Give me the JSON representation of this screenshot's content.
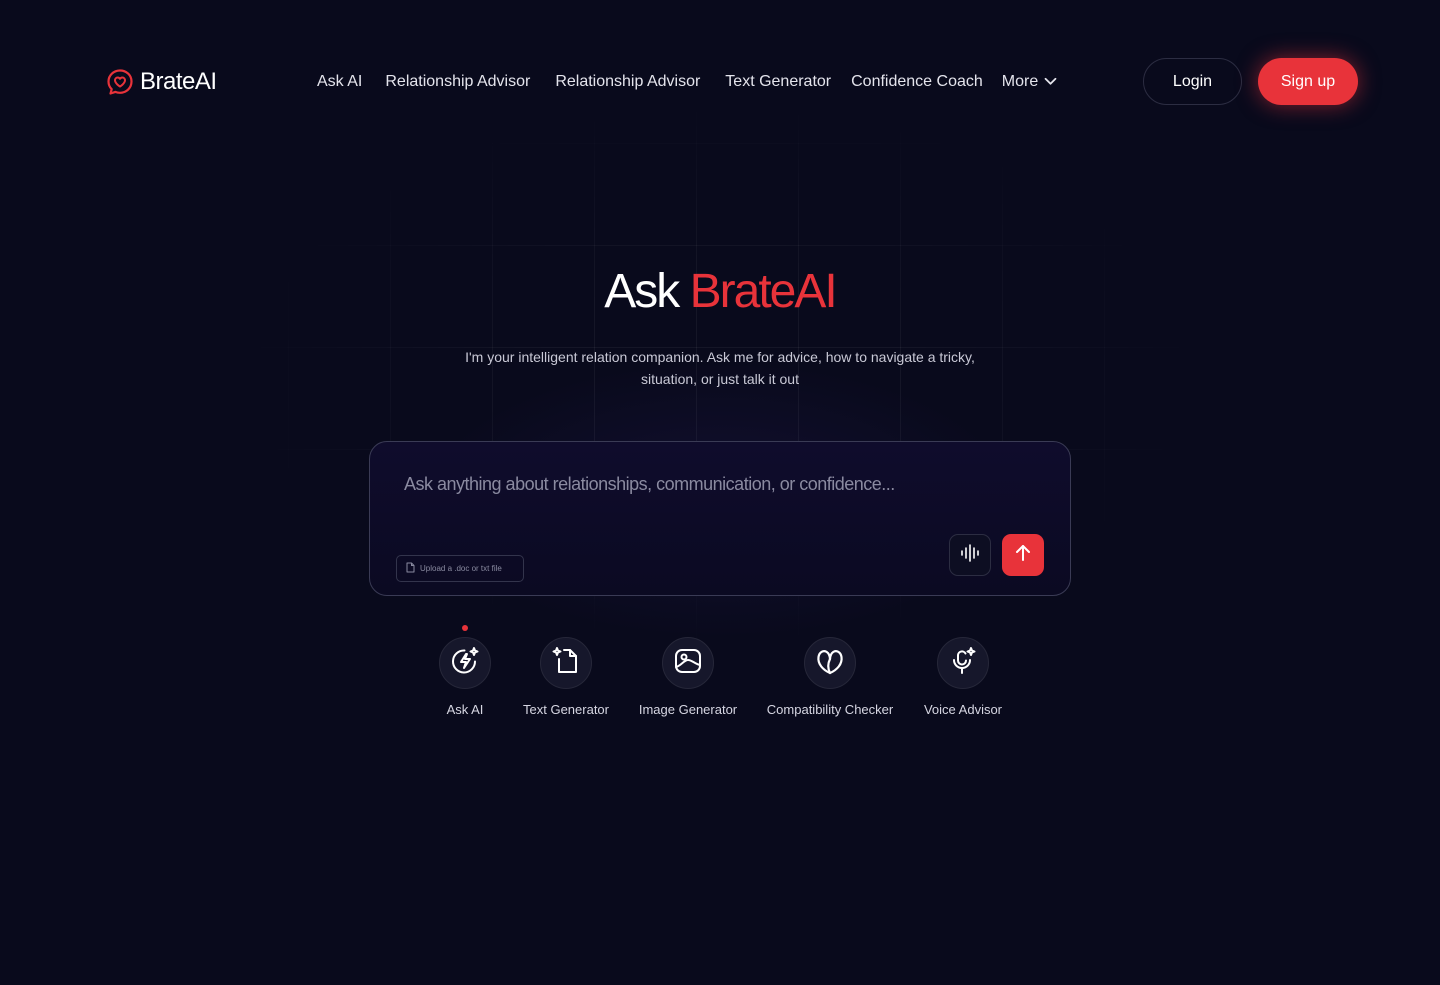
{
  "brand": {
    "name": "BrateAI",
    "accent_color": "#e8333a",
    "logo_icon": "chat-heart-icon"
  },
  "nav": {
    "items": [
      {
        "label": "Ask AI"
      },
      {
        "label": "Relationship Advisor"
      },
      {
        "label": "Relationship Advisor"
      },
      {
        "label": "Text Generator"
      },
      {
        "label": "Confidence Coach"
      }
    ],
    "more_label": "More",
    "more_icon": "chevron-down-icon"
  },
  "auth": {
    "login_label": "Login",
    "signup_label": "Sign up"
  },
  "hero": {
    "title_prefix": "Ask",
    "title_accent": "BrateAI",
    "subtitle": "I'm your intelligent relation companion. Ask me for advice, how to navigate a tricky, situation, or just talk it out"
  },
  "chat": {
    "placeholder": "Ask anything about relationships, communication, or confidence...",
    "value": "",
    "upload_label": "Upload a .doc or txt file",
    "upload_icon": "file-icon",
    "voice_icon": "waveform-icon",
    "send_icon": "arrow-up-icon"
  },
  "tools": [
    {
      "label": "Ask AI",
      "icon": "lightning-sparkle-icon",
      "active": true
    },
    {
      "label": "Text Generator",
      "icon": "document-sparkle-icon",
      "active": false
    },
    {
      "label": "Image Generator",
      "icon": "image-icon",
      "active": false
    },
    {
      "label": "Compatibility Checker",
      "icon": "heart-outline-icon",
      "active": false
    },
    {
      "label": "Voice Advisor",
      "icon": "microphone-sparkle-icon",
      "active": false
    }
  ]
}
